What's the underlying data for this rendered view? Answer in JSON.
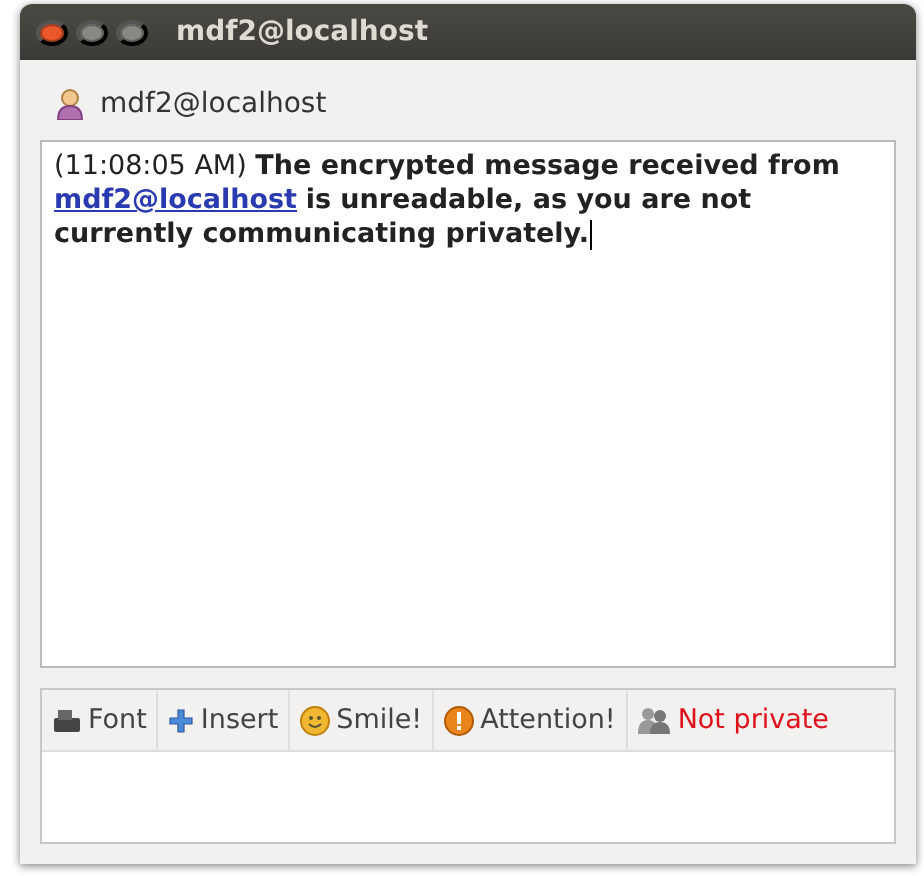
{
  "window": {
    "title": "mdf2@localhost"
  },
  "contact": {
    "name": "mdf2@localhost"
  },
  "message": {
    "time": "(11:08:05 AM)",
    "text_before": "The encrypted message received from",
    "link": "mdf2@localhost",
    "text_after": "is unreadable, as you are not currently communicating privately."
  },
  "toolbar": [
    {
      "kind": "font",
      "label": "Font"
    },
    {
      "kind": "insert",
      "label": "Insert"
    },
    {
      "kind": "smile",
      "label": "Smile!"
    },
    {
      "kind": "attention",
      "label": "Attention!"
    },
    {
      "kind": "privacy",
      "label": "Not private"
    }
  ]
}
